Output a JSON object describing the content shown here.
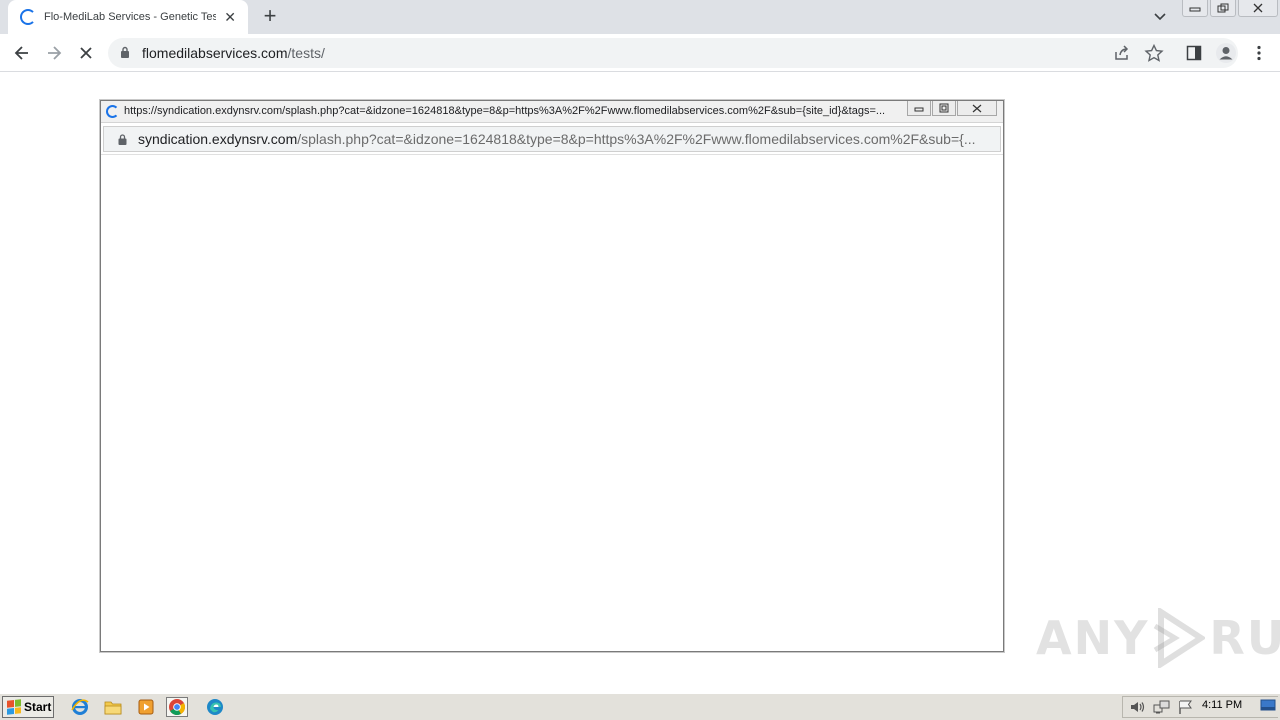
{
  "browser": {
    "tab": {
      "title": "Flo-MediLab Services - Genetic Tests",
      "close_glyph": "✕"
    },
    "new_tab_glyph": "+",
    "address": {
      "host": "flomedilabservices.com",
      "path": "/tests/"
    }
  },
  "popup": {
    "title": "https://syndication.exdynsrv.com/splash.php?cat=&idzone=1624818&type=8&p=https%3A%2F%2Fwww.flomedilabservices.com%2F&sub={site_id}&tags=...",
    "address": {
      "host": "syndication.exdynsrv.com",
      "path": "/splash.php?cat=&idzone=1624818&type=8&p=https%3A%2F%2Fwww.flomedilabservices.com%2F&sub={..."
    }
  },
  "watermark": {
    "left": "ANY",
    "right": "RUN"
  },
  "taskbar": {
    "start_label": "Start",
    "clock": "4:11 PM",
    "icons": [
      "ie-icon",
      "explorer-icon",
      "media-player-icon",
      "chrome-icon",
      "edge-icon"
    ]
  },
  "colors": {
    "accent": "#1a73e8",
    "tabstrip": "#dee1e6",
    "taskbar": "#e3e1db"
  }
}
